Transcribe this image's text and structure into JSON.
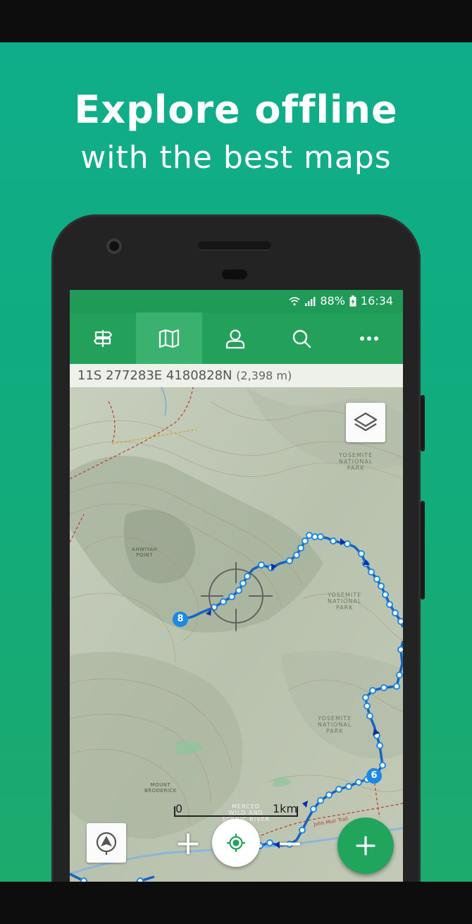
{
  "promo": {
    "headline": "Explore offline",
    "subheadline": "with the best maps"
  },
  "status_bar": {
    "battery": "88%",
    "time": "16:34"
  },
  "nav": {
    "items": [
      {
        "name": "routes",
        "icon": "signpost-icon"
      },
      {
        "name": "map",
        "icon": "map-icon",
        "active": true
      },
      {
        "name": "profile",
        "icon": "user-icon"
      },
      {
        "name": "search",
        "icon": "search-icon"
      },
      {
        "name": "more",
        "icon": "more-icon"
      }
    ]
  },
  "coords": {
    "value": "11S 277283E 4180828N",
    "altitude": "(2,398 m)"
  },
  "map": {
    "labels": {
      "yosemite_park_1": [
        "YOSEMITE",
        "NATIONAL",
        "PARK"
      ],
      "yosemite_park_2": [
        "YOSEMITE",
        "NATIONAL",
        "PARK"
      ],
      "yosemite_park_3": [
        "YOSEMITE",
        "NATIONAL",
        "PARK"
      ],
      "merced": [
        "MERCED",
        "WILD AND",
        "SCENIC RIVER"
      ],
      "mount_broderick": [
        "MOUNT",
        "BRODERICK"
      ],
      "ahwiyah": [
        "AHWIYAH",
        "POINT"
      ],
      "john_muir_trail": "John Muir Trail"
    },
    "waypoint_1": "8",
    "waypoint_2": "6",
    "scale_start": "0",
    "scale_end": "1km"
  },
  "colors": {
    "brand_green": "#23a15b",
    "track_blue": "#1565c0",
    "promo_teal": "#11ab7c"
  }
}
